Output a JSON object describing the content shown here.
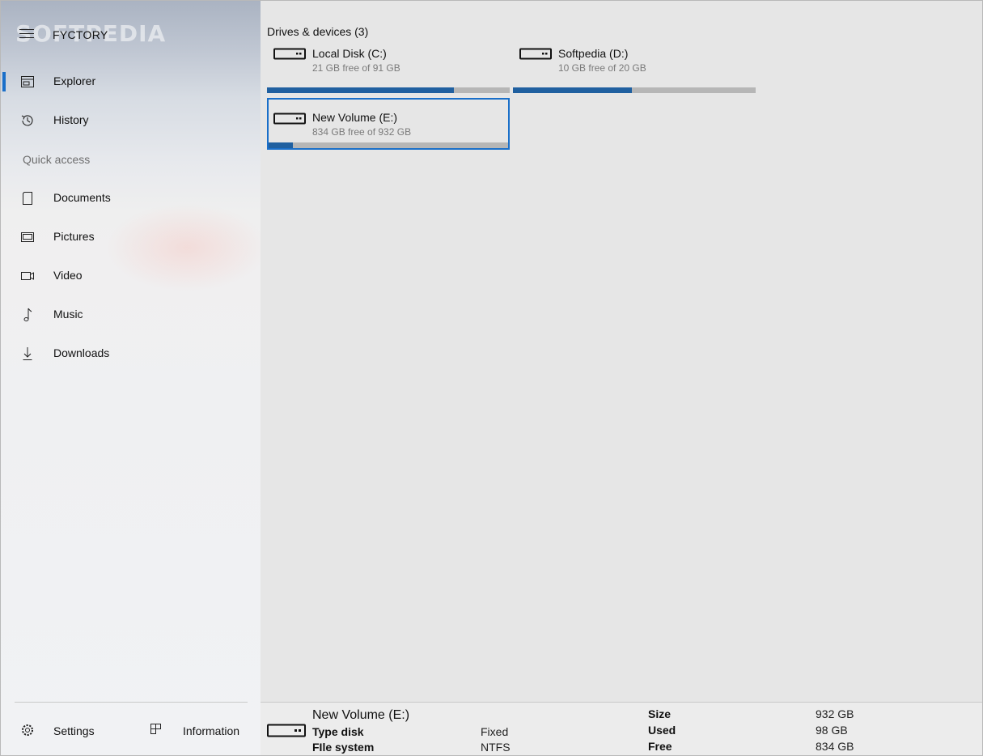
{
  "app": {
    "title": "FYCTORY",
    "watermark": "SOFTPEDIA"
  },
  "window_controls": {
    "minimize": "minimize-icon",
    "maximize": "maximize-icon",
    "close": "close-icon"
  },
  "sidebar": {
    "items": [
      {
        "label": "Explorer",
        "icon": "explorer-icon",
        "active": true
      },
      {
        "label": "History",
        "icon": "history-icon",
        "active": false
      }
    ],
    "quick_access_label": "Quick access",
    "quick_access": [
      {
        "label": "Documents",
        "icon": "document-icon"
      },
      {
        "label": "Pictures",
        "icon": "pictures-icon"
      },
      {
        "label": "Video",
        "icon": "video-icon"
      },
      {
        "label": "Music",
        "icon": "music-icon"
      },
      {
        "label": "Downloads",
        "icon": "download-icon"
      }
    ],
    "settings_label": "Settings",
    "information_label": "Information"
  },
  "main": {
    "header": "Drives & devices (3)",
    "drives": [
      {
        "name": "Local Disk (C:)",
        "free_text": "21 GB free of 91 GB",
        "used_fraction": 0.77,
        "selected": false
      },
      {
        "name": "Softpedia (D:)",
        "free_text": "10 GB free of 20 GB",
        "used_fraction": 0.49,
        "selected": false
      },
      {
        "name": "New Volume (E:)",
        "free_text": "834 GB free of 932 GB",
        "used_fraction": 0.1,
        "selected": true
      }
    ]
  },
  "details": {
    "title": "New Volume (E:)",
    "type_disk_label": "Type disk",
    "type_disk_value": "Fixed",
    "file_system_label": "FIle system",
    "file_system_value": "NTFS",
    "size_label": "Size",
    "size_value": "932 GB",
    "used_label": "Used",
    "used_value": "98 GB",
    "free_label": "Free",
    "free_value": "834 GB"
  },
  "colors": {
    "accent": "#1a6fc9",
    "usage_fill": "#2060a0",
    "usage_track": "#b6b6b6"
  }
}
